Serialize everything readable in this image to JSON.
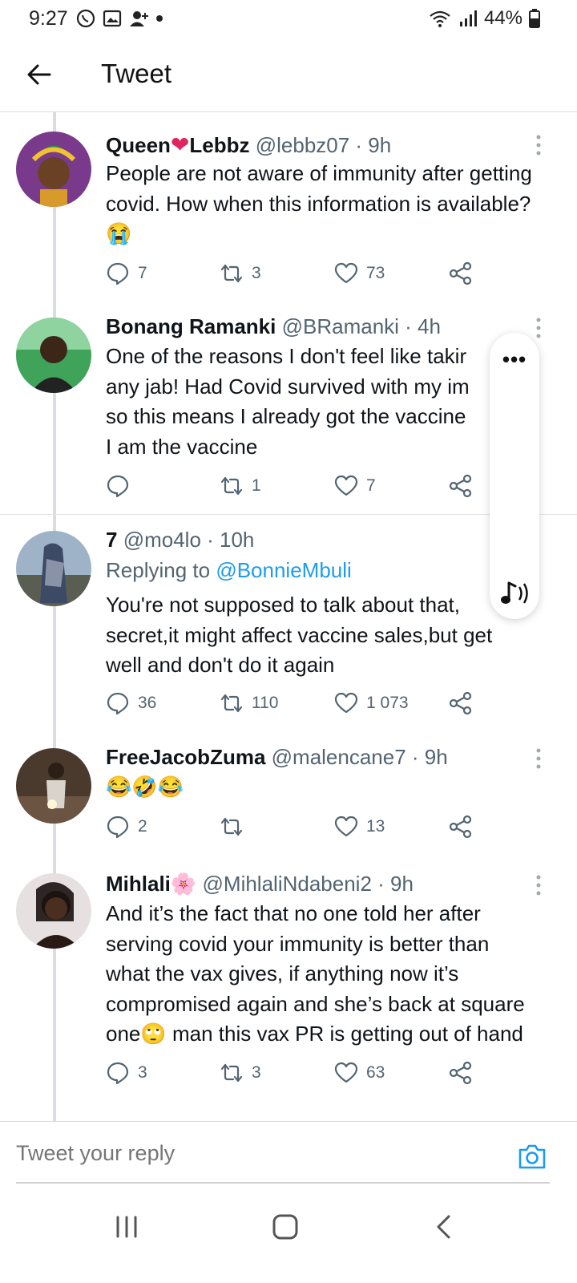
{
  "status_bar": {
    "time": "9:27",
    "battery": "44%",
    "left_icons": [
      "whatsapp-icon",
      "gallery-icon",
      "contacts-icon",
      "dot-icon"
    ],
    "right_icons": [
      "wifi-icon",
      "signal-icon",
      "battery-icon"
    ]
  },
  "header": {
    "title": "Tweet"
  },
  "tweets": [
    {
      "name_part1": "Queen",
      "name_heart": "❤",
      "name_part2": "Lebbz",
      "handle_time": "@lebbz07 · 9h",
      "text": "People are not aware of immunity after getting covid. How when this information is available?😭",
      "replies": "7",
      "retweets": "3",
      "likes": "73"
    },
    {
      "name": "Bonang Ramanki",
      "handle_time": "@BRamanki · 4h",
      "lines": [
        "One of the reasons I don't feel like takir",
        "any jab! Had Covid survived with my im",
        "so this means I already got the vaccine",
        "I am the vaccine"
      ],
      "replies": "",
      "retweets": "1",
      "likes": "7"
    },
    {
      "name": "7",
      "handle_time": "@mo4lo · 10h",
      "replying_prefix": "Replying to",
      "replying_to": "@BonnieMbuli",
      "lines": [
        "You're not supposed to talk about that,",
        "secret,it might affect vaccine sales,but get",
        "well and don't do it again"
      ],
      "replies": "36",
      "retweets": "110",
      "likes": "1 073"
    },
    {
      "name": "FreeJacobZuma",
      "handle_time": "@malencane7 · 9h",
      "text": "😂🤣😂",
      "replies": "2",
      "retweets": "",
      "likes": "13"
    },
    {
      "name": "Mihlali🌸",
      "handle_time": "@MihlaliNdabeni2 · 9h",
      "lines": [
        "And it’s the fact that no one told her after",
        "serving covid your immunity is better than",
        "what the vax gives, if anything now it’s",
        "compromised again and she’s back at square",
        "one🙄 man this vax PR is getting out of hand"
      ],
      "replies": "3",
      "retweets": "3",
      "likes": "63"
    }
  ],
  "overlay": {
    "more": "•••",
    "icon": "speaker-music-icon"
  },
  "reply_bar": {
    "placeholder": "Tweet your reply",
    "icon": "camera-icon"
  },
  "nav": {
    "icons": [
      "recents-icon",
      "home-icon",
      "back-nav-icon"
    ]
  },
  "colors": {
    "accent": "#1d9bf0",
    "secondary_text": "#536471",
    "heart": "#e0245e"
  }
}
